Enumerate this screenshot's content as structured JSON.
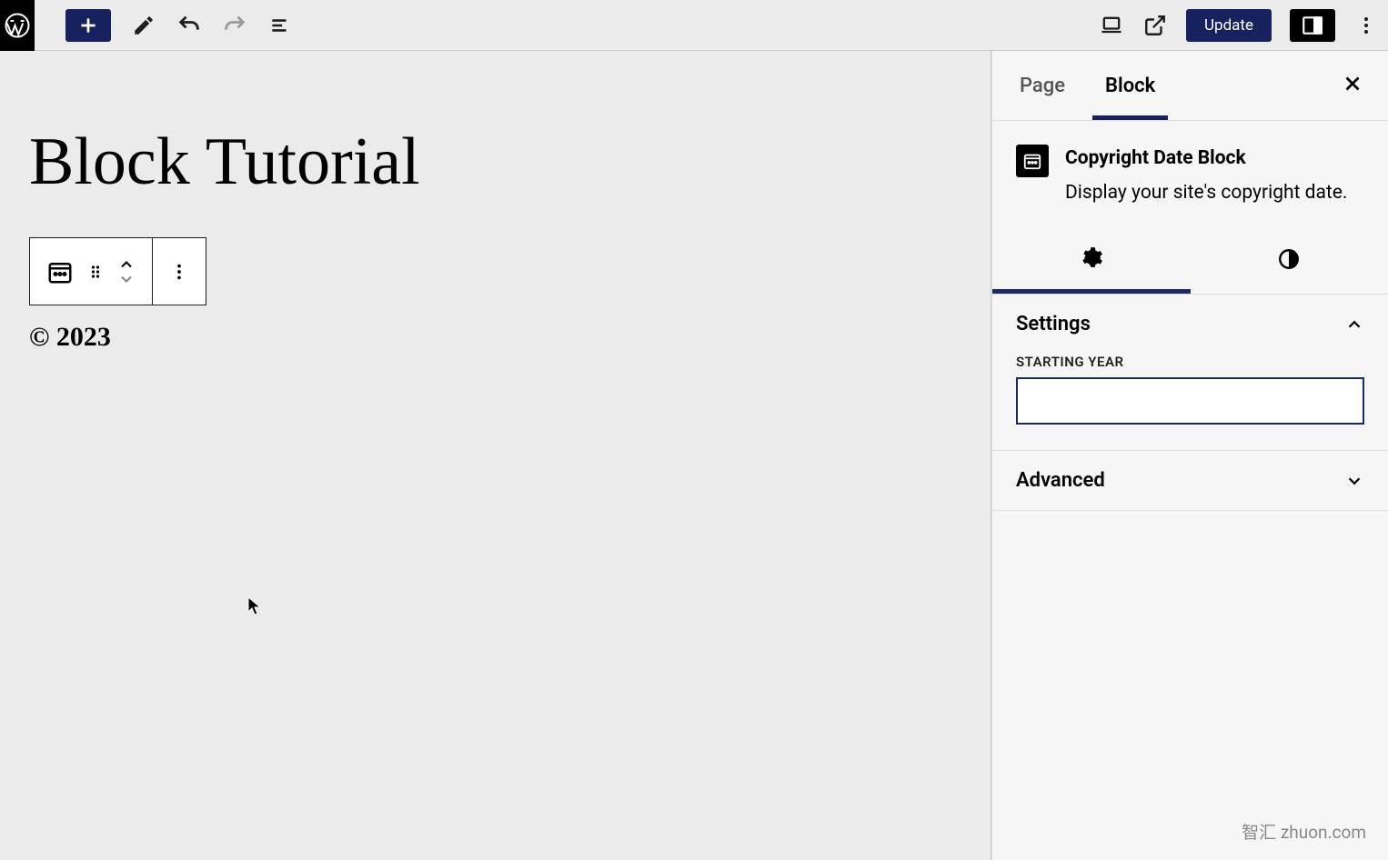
{
  "toolbar": {
    "update_label": "Update"
  },
  "page": {
    "title": "Block Tutorial",
    "copyright_display": "© 2023"
  },
  "sidebar": {
    "tabs": {
      "page": "Page",
      "block": "Block"
    },
    "block_info": {
      "title": "Copyright Date Block",
      "description": "Display your site's copyright date."
    },
    "settings_panel": {
      "title": "Settings",
      "starting_year_label": "Starting Year",
      "starting_year_value": ""
    },
    "advanced_panel": {
      "title": "Advanced"
    }
  },
  "watermark": "智汇 zhuon.com"
}
